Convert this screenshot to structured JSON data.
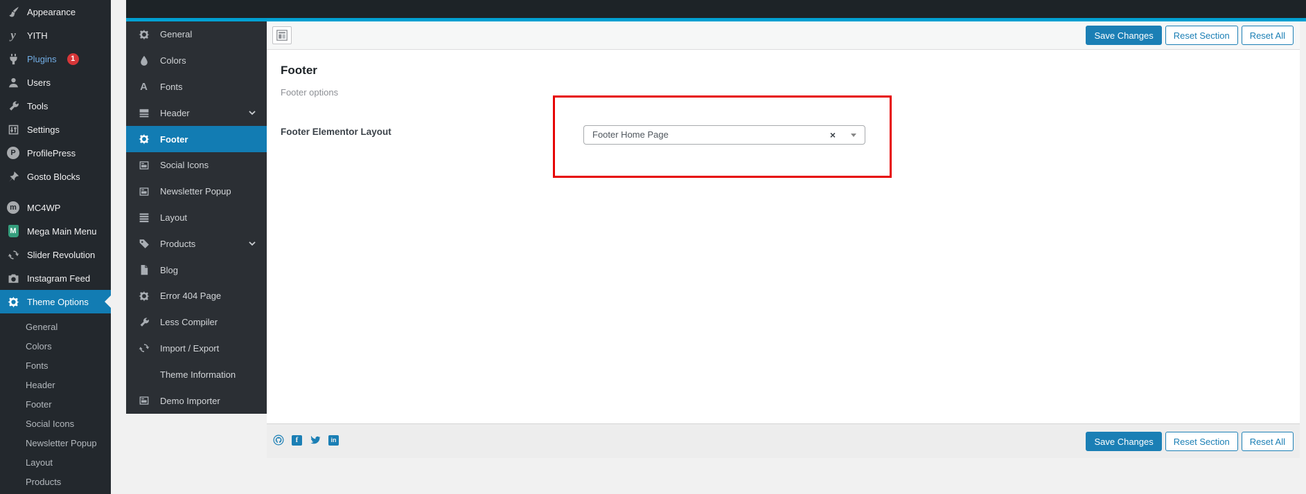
{
  "admin_sidebar": {
    "items": [
      {
        "label": "Appearance"
      },
      {
        "label": "YITH"
      },
      {
        "label": "Plugins",
        "badge": "1"
      },
      {
        "label": "Users"
      },
      {
        "label": "Tools"
      },
      {
        "label": "Settings"
      },
      {
        "label": "ProfilePress"
      },
      {
        "label": "Gosto Blocks"
      },
      {
        "label": "MC4WP"
      },
      {
        "label": "Mega Main Menu"
      },
      {
        "label": "Slider Revolution"
      },
      {
        "label": "Instagram Feed"
      },
      {
        "label": "Theme Options"
      }
    ],
    "submenu": [
      "General",
      "Colors",
      "Fonts",
      "Header",
      "Footer",
      "Social Icons",
      "Newsletter Popup",
      "Layout",
      "Products"
    ]
  },
  "options_menu": {
    "items": [
      "General",
      "Colors",
      "Fonts",
      "Header",
      "Footer",
      "Social Icons",
      "Newsletter Popup",
      "Layout",
      "Products",
      "Blog",
      "Error 404 Page",
      "Less Compiler",
      "Import / Export",
      "Theme Information",
      "Demo Importer"
    ]
  },
  "toolbar": {
    "save": "Save Changes",
    "reset_section": "Reset Section",
    "reset_all": "Reset All"
  },
  "content": {
    "title": "Footer",
    "subtitle": "Footer options",
    "field_label": "Footer Elementor Layout",
    "select_value": "Footer Home Page",
    "select_clear": "×"
  },
  "icon_glyphs": {
    "yith": "y",
    "profilepress": "P",
    "mc4wp": "m",
    "mega_main_menu": "M",
    "fonts": "A",
    "facebook": "f",
    "linkedin": "in"
  },
  "colors": {
    "accent_line": "#00a0d2",
    "active_blue": "#127cb3",
    "button_blue": "#1b7fb5",
    "badge_red": "#d63638",
    "highlight_red": "#e60000",
    "sidebar_dark": "#23282d",
    "panel_dark": "#2b2f34"
  }
}
